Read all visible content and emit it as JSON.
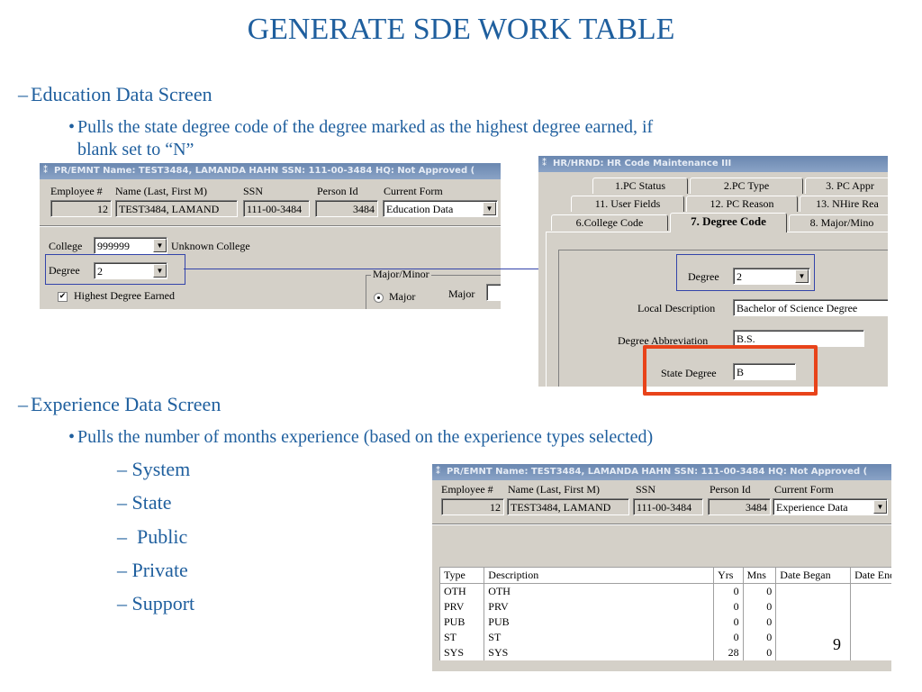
{
  "title": "GENERATE SDE WORK TABLE",
  "sections": {
    "education": {
      "dash": "–",
      "heading": "Education Data Screen",
      "bullet": "Pulls the state degree code of the degree marked as the highest degree earned, if",
      "bullet_line2": "blank set to “N”"
    },
    "experience": {
      "dash": "–",
      "heading": "Experience Data Screen",
      "bullet": "Pulls the number of months experience (based on the experience types selected)",
      "items": [
        "System",
        "State",
        " Public",
        "Private",
        "Support"
      ]
    },
    "bullet_glyph": "•",
    "sub_dash": "–"
  },
  "page_number": "9",
  "emnt_education": {
    "title": "PR/EMNT  Name: TEST3484, LAMANDA HAHN SSN: 111-00-3484 HQ: Not Approved (",
    "labels": {
      "employee": "Employee #",
      "name": "Name (Last, First M)",
      "ssn": "SSN",
      "person_id": "Person Id",
      "current_form": "Current Form"
    },
    "values": {
      "employee": "12",
      "name": "TEST3484, LAMAND",
      "ssn": "111-00-3484",
      "person_id": "3484",
      "current_form": "Education Data"
    },
    "college_label": "College",
    "college_value": "999999",
    "college_name": "Unknown College",
    "degree_label": "Degree",
    "degree_value": "2",
    "highest_label": "Highest Degree Earned",
    "highest_checked": "✔",
    "major_minor_label": "Major/Minor",
    "major_radio_label": "Major",
    "major_label": "Major"
  },
  "hrnd": {
    "title": "HR/HRND: HR Code Maintenance III",
    "tabs_row1": [
      "1.PC Status",
      "2.PC Type",
      "3. PC Appr"
    ],
    "tabs_row2": [
      "11. User Fields",
      "12. PC Reason",
      "13. NHire Rea"
    ],
    "tabs_row3": [
      "6.College Code",
      "7. Degree Code",
      "8. Major/Mino"
    ],
    "degree_label": "Degree",
    "degree_value": "2",
    "local_desc_label": "Local Description",
    "local_desc_value": "Bachelor of Science Degree",
    "abbrev_label": "Degree Abbreviation",
    "abbrev_value": "B.S.",
    "state_degree_label": "State Degree",
    "state_degree_value": "B"
  },
  "emnt_experience": {
    "title": "PR/EMNT  Name: TEST3484, LAMANDA HAHN SSN: 111-00-3484 HQ: Not Approved (",
    "labels": {
      "employee": "Employee #",
      "name": "Name (Last, First M)",
      "ssn": "SSN",
      "person_id": "Person Id",
      "current_form": "Current Form"
    },
    "values": {
      "employee": "12",
      "name": "TEST3484, LAMAND",
      "ssn": "111-00-3484",
      "person_id": "3484",
      "current_form": "Experience Data"
    },
    "table": {
      "headers": [
        "Type",
        "Description",
        "Yrs",
        "Mns",
        "Date Began",
        "Date End"
      ],
      "rows": [
        [
          "OTH",
          "OTH",
          "0",
          "0",
          "",
          ""
        ],
        [
          "PRV",
          "PRV",
          "0",
          "0",
          "",
          ""
        ],
        [
          "PUB",
          "PUB",
          "0",
          "0",
          "",
          ""
        ],
        [
          "ST",
          "ST",
          "0",
          "0",
          "",
          ""
        ],
        [
          "SYS",
          "SYS",
          "28",
          "0",
          "",
          ""
        ]
      ]
    }
  },
  "colors": {
    "heading_blue": "#1f5f9e",
    "highlight_red": "#e8431a",
    "connector_blue": "#3344aa"
  }
}
